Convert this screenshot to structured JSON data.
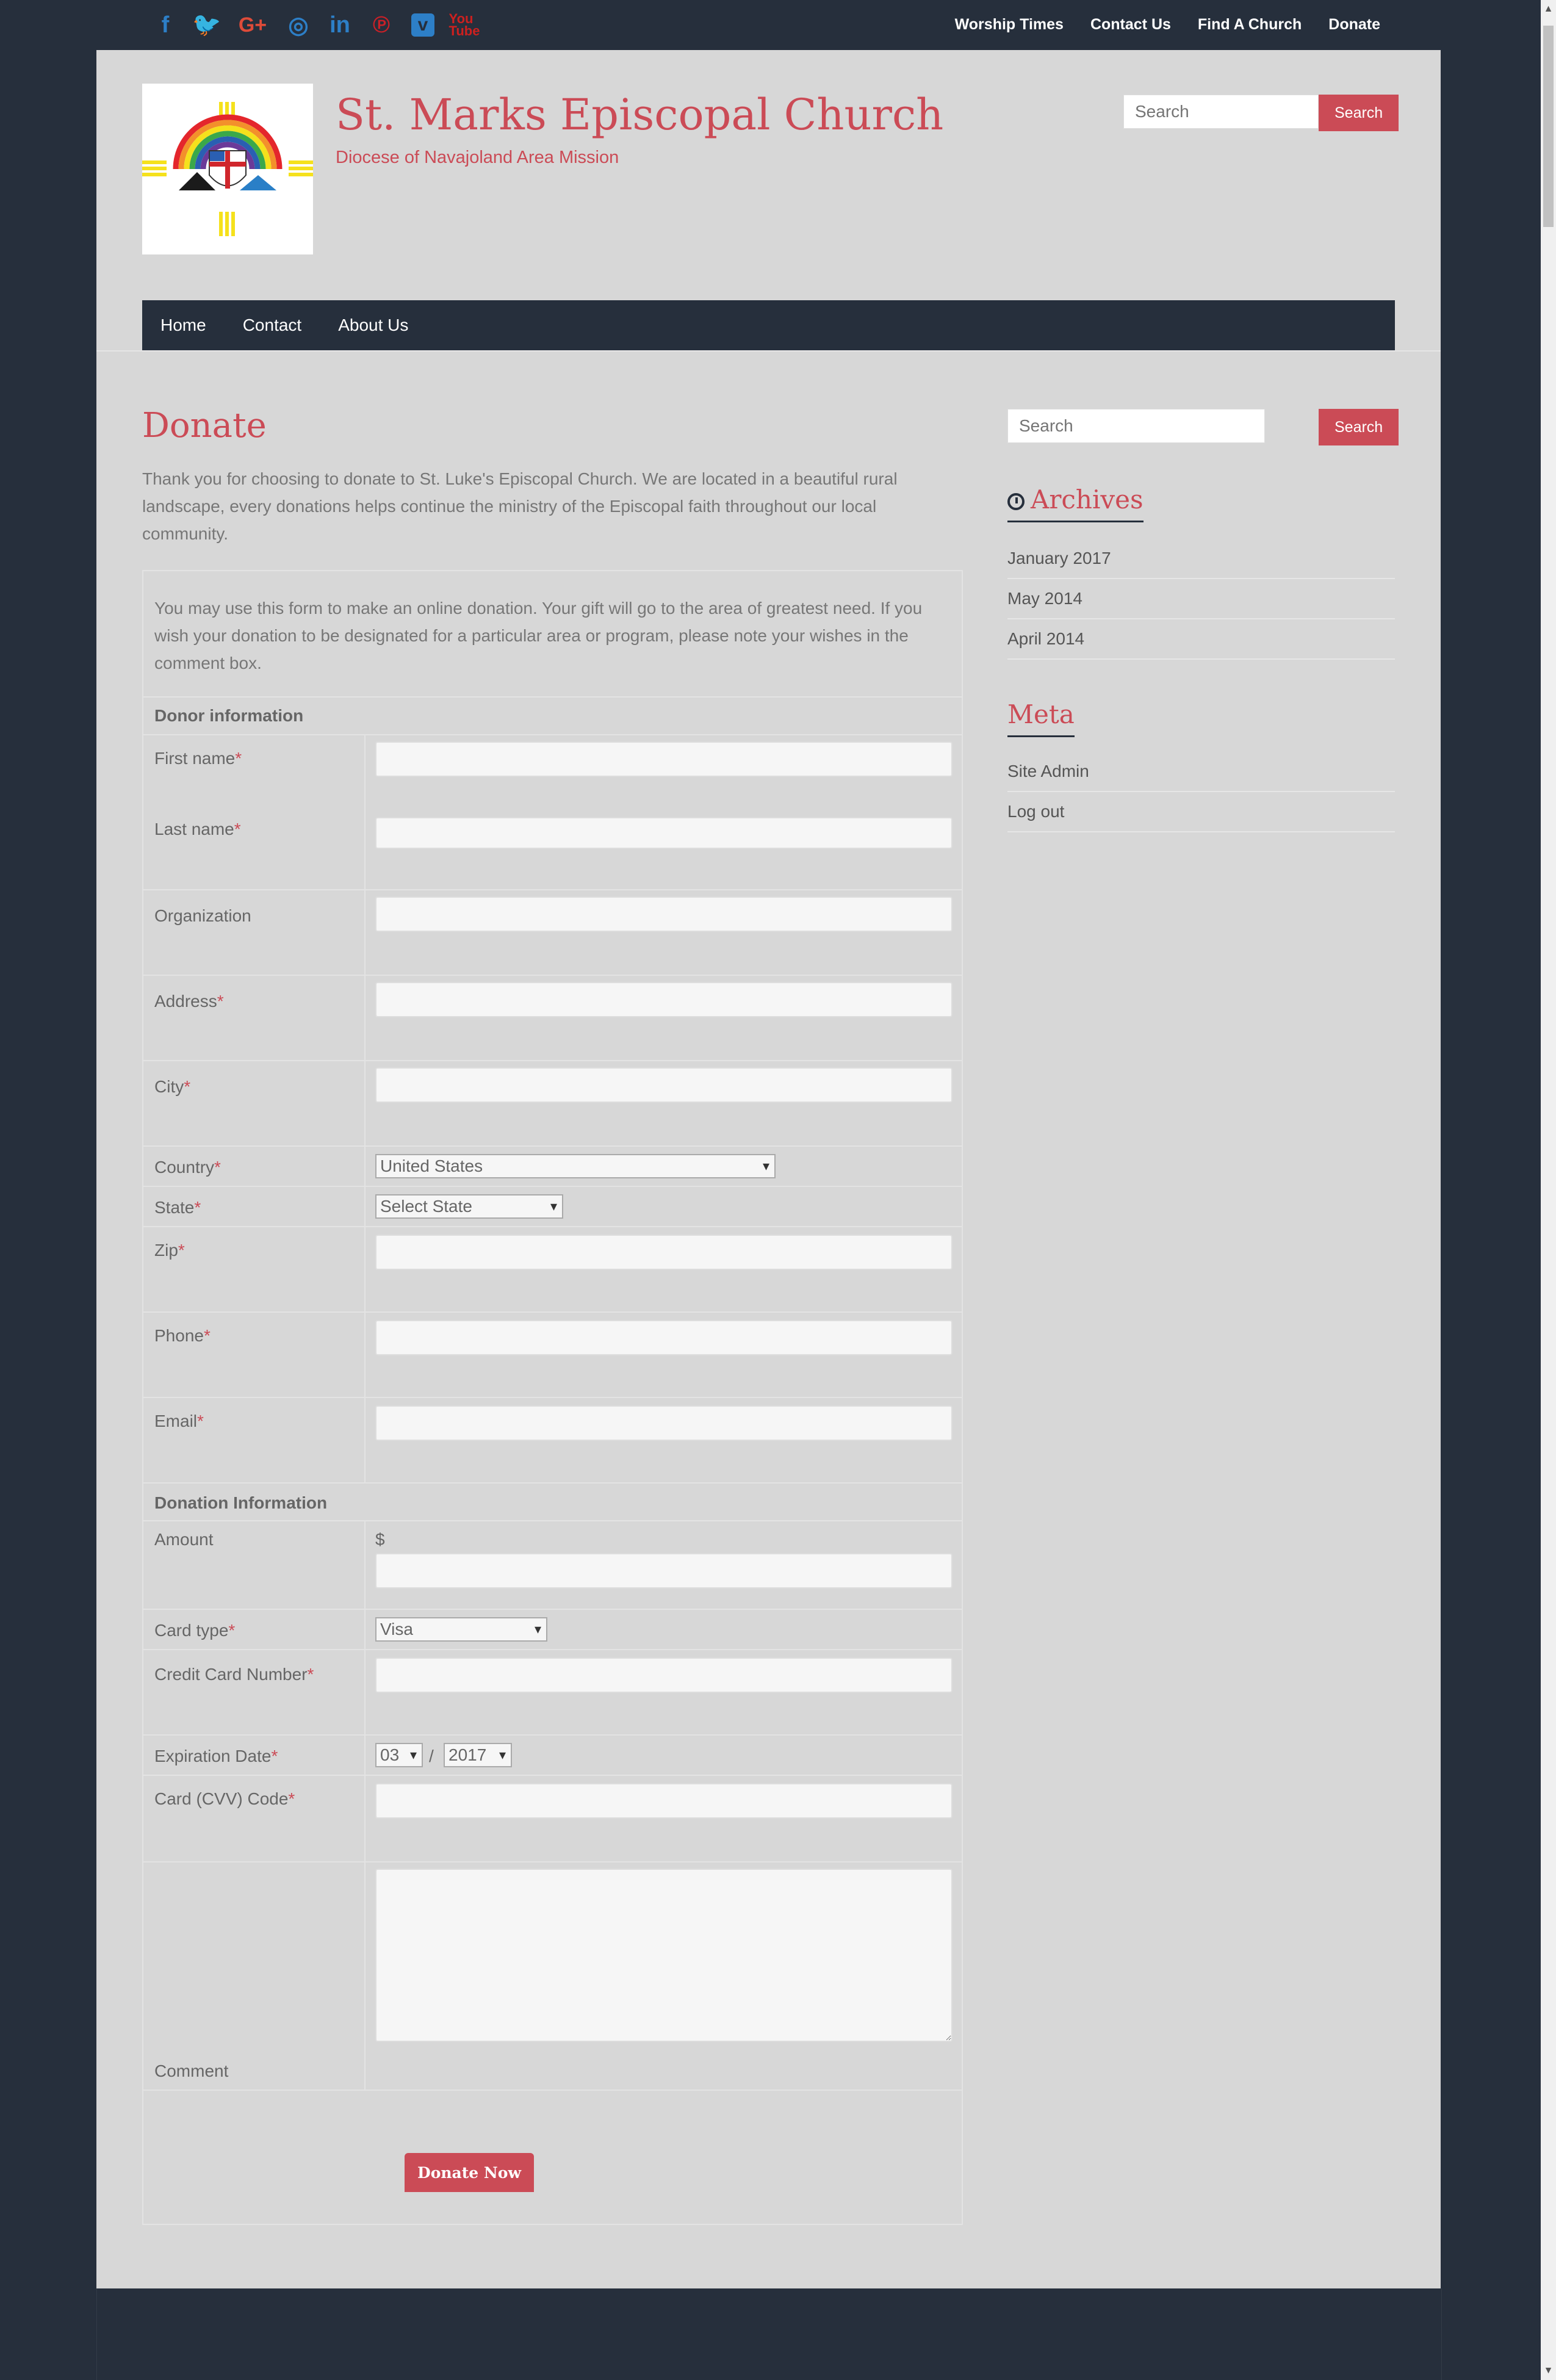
{
  "topbar": {
    "social": [
      {
        "icon": "facebook-icon",
        "glyph": "f"
      },
      {
        "icon": "twitter-icon",
        "glyph": "🐦"
      },
      {
        "icon": "google-plus-icon",
        "glyph": "G+"
      },
      {
        "icon": "instagram-icon",
        "glyph": "◎"
      },
      {
        "icon": "linkedin-icon",
        "glyph": "in"
      },
      {
        "icon": "pinterest-icon",
        "glyph": "℗"
      },
      {
        "icon": "vimeo-icon",
        "glyph": "v"
      },
      {
        "icon": "youtube-icon",
        "glyph": "You Tube"
      }
    ],
    "nav": [
      "Worship Times",
      "Contact Us",
      "Find A Church",
      "Donate"
    ]
  },
  "header": {
    "title": "St. Marks Episcopal Church",
    "description": "Diocese of Navajoland Area Mission",
    "search_placeholder": "Search",
    "search_button": "Search"
  },
  "mainnav": [
    "Home",
    "Contact",
    "About Us"
  ],
  "page": {
    "title": "Donate",
    "intro": "Thank you for choosing to donate to St. Luke's Episcopal Church. We are located in a beautiful rural landscape, every donations helps continue the ministry of the Episcopal faith throughout our local community."
  },
  "form": {
    "note": "You may use this form to make an online donation. Your gift will go to the area of greatest need. If you wish your donation to be designated for a particular area or program, please note your wishes in the comment box.",
    "donor_section": "Donor information",
    "first_name": "First name",
    "last_name": "Last name",
    "organization": "Organization",
    "address": "Address",
    "city": "City",
    "country": "Country",
    "country_value": "United States",
    "state": "State",
    "state_value": "Select State",
    "zip": "Zip",
    "phone": "Phone",
    "email": "Email",
    "donation_section": "Donation Information",
    "amount": "Amount",
    "currency": "$",
    "card_type": "Card type",
    "card_type_value": "Visa",
    "card_number": "Credit Card Number",
    "expiration": "Expiration Date",
    "exp_month": "03",
    "exp_sep": "/",
    "exp_year": "2017",
    "cvv": "Card (CVV) Code",
    "comment": "Comment",
    "required_mark": "*",
    "submit": "Donate Now"
  },
  "sidebar": {
    "search_placeholder": "Search",
    "search_button": "Search",
    "archives_title": "Archives",
    "archives": [
      "January 2017",
      "May 2014",
      "April 2014"
    ],
    "meta_title": "Meta",
    "meta": [
      "Site Admin",
      "Log out"
    ]
  },
  "colors": {
    "accent": "#cb4b56",
    "dark": "#262f3c",
    "page_bg": "#d7d7d7"
  }
}
